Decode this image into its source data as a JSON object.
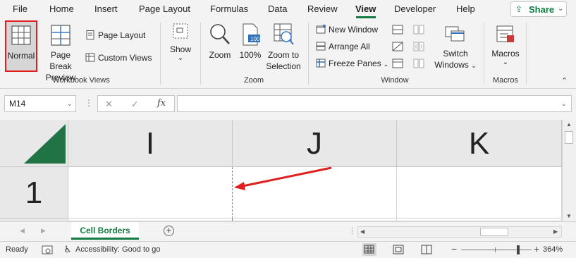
{
  "menu": {
    "items": [
      "File",
      "Home",
      "Insert",
      "Page Layout",
      "Formulas",
      "Data",
      "Review",
      "View",
      "Developer",
      "Help"
    ],
    "active": "View",
    "share_label": "Share"
  },
  "ribbon": {
    "workbook_views": {
      "group_label": "Workbook Views",
      "normal": "Normal",
      "page_break_preview_line1": "Page Break",
      "page_break_preview_line2": "Preview",
      "page_layout": "Page Layout",
      "custom_views": "Custom Views"
    },
    "show": {
      "label": "Show"
    },
    "zoom": {
      "group_label": "Zoom",
      "zoom": "Zoom",
      "hundred": "100%",
      "zoom_to_selection_line1": "Zoom to",
      "zoom_to_selection_line2": "Selection",
      "hundred_icon_text": "100"
    },
    "window": {
      "group_label": "Window",
      "new_window": "New Window",
      "arrange_all": "Arrange All",
      "freeze_panes": "Freeze Panes",
      "switch_windows_line1": "Switch",
      "switch_windows_line2": "Windows"
    },
    "macros": {
      "group_label": "Macros",
      "macros": "Macros"
    }
  },
  "formula_bar": {
    "name_box": "M14",
    "fx": "fx",
    "cancel": "✕",
    "enter": "✓",
    "formula": ""
  },
  "grid": {
    "columns": [
      "I",
      "J",
      "K"
    ],
    "rows": [
      "1"
    ]
  },
  "sheets": {
    "tabs": [
      "Cell Borders"
    ],
    "active": "Cell Borders",
    "add_label": "+"
  },
  "status": {
    "ready": "Ready",
    "accessibility": "Accessibility: Good to go",
    "zoom": "364%"
  },
  "colors": {
    "accent": "#107c41",
    "annotation": "#e02020",
    "highlight_border": "#e02020"
  }
}
